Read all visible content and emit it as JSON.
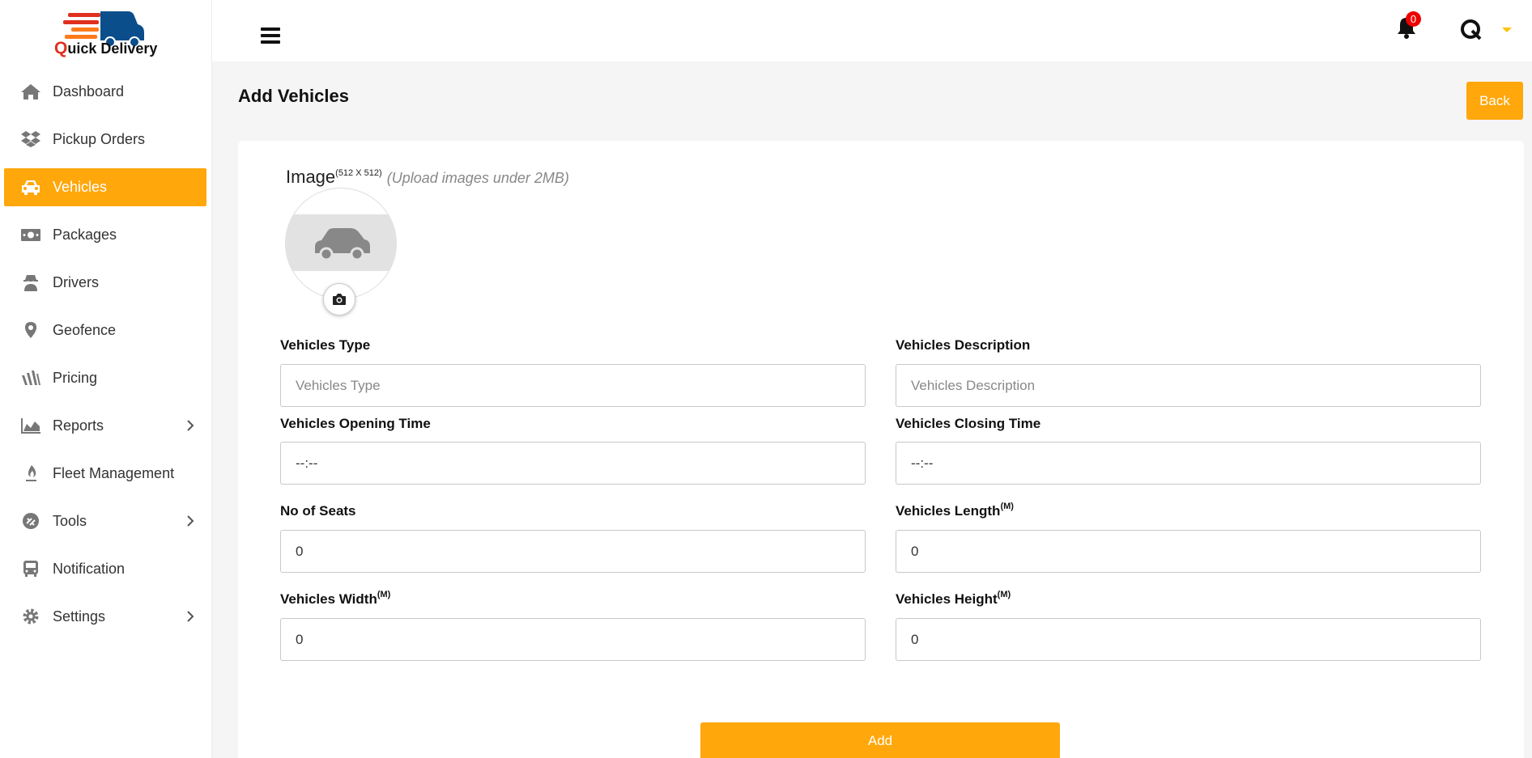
{
  "app": {
    "logo_first": "Q",
    "logo_rest": "uick Delivery"
  },
  "sidebar": {
    "items": [
      {
        "label": "Dashboard",
        "icon": "home-icon",
        "active": false
      },
      {
        "label": "Pickup Orders",
        "icon": "dropbox-icon",
        "active": false
      },
      {
        "label": "Vehicles",
        "icon": "car-icon",
        "active": true
      },
      {
        "label": "Packages",
        "icon": "money-icon",
        "active": false
      },
      {
        "label": "Drivers",
        "icon": "user-secret-icon",
        "active": false
      },
      {
        "label": "Geofence",
        "icon": "map-marker-icon",
        "active": false
      },
      {
        "label": "Pricing",
        "icon": "pricing-icon",
        "active": false
      },
      {
        "label": "Reports",
        "icon": "area-chart-icon",
        "active": false,
        "has_submenu": true
      },
      {
        "label": "Fleet Management",
        "icon": "fire-icon",
        "active": false
      },
      {
        "label": "Tools",
        "icon": "tools-icon",
        "active": false,
        "has_submenu": true
      },
      {
        "label": "Notification",
        "icon": "bus-icon",
        "active": false
      },
      {
        "label": "Settings",
        "icon": "gear-icon",
        "active": false,
        "has_submenu": true
      }
    ]
  },
  "topbar": {
    "notification_count": "0",
    "accent": "#ffa70b"
  },
  "page": {
    "title": "Add Vehicles",
    "back_label": "Back"
  },
  "form": {
    "image_label": "Image",
    "image_size": "(512 X 512)",
    "image_hint": "(Upload images under 2MB)",
    "vehicles_type": {
      "label": "Vehicles Type",
      "placeholder": "Vehicles Type",
      "value": ""
    },
    "vehicles_description": {
      "label": "Vehicles Description",
      "placeholder": "Vehicles Description",
      "value": ""
    },
    "opening_time": {
      "label": "Vehicles Opening Time",
      "value": "--:--"
    },
    "closing_time": {
      "label": "Vehicles Closing Time",
      "value": "--:--"
    },
    "no_of_seats": {
      "label": "No of Seats",
      "value": "0"
    },
    "vehicles_length": {
      "label": "Vehicles Length",
      "unit": "(M)",
      "value": "0"
    },
    "vehicles_width": {
      "label": "Vehicles Width",
      "unit": "(M)",
      "value": "0"
    },
    "vehicles_height": {
      "label": "Vehicles Height",
      "unit": "(M)",
      "value": "0"
    },
    "submit_label": "Add"
  }
}
